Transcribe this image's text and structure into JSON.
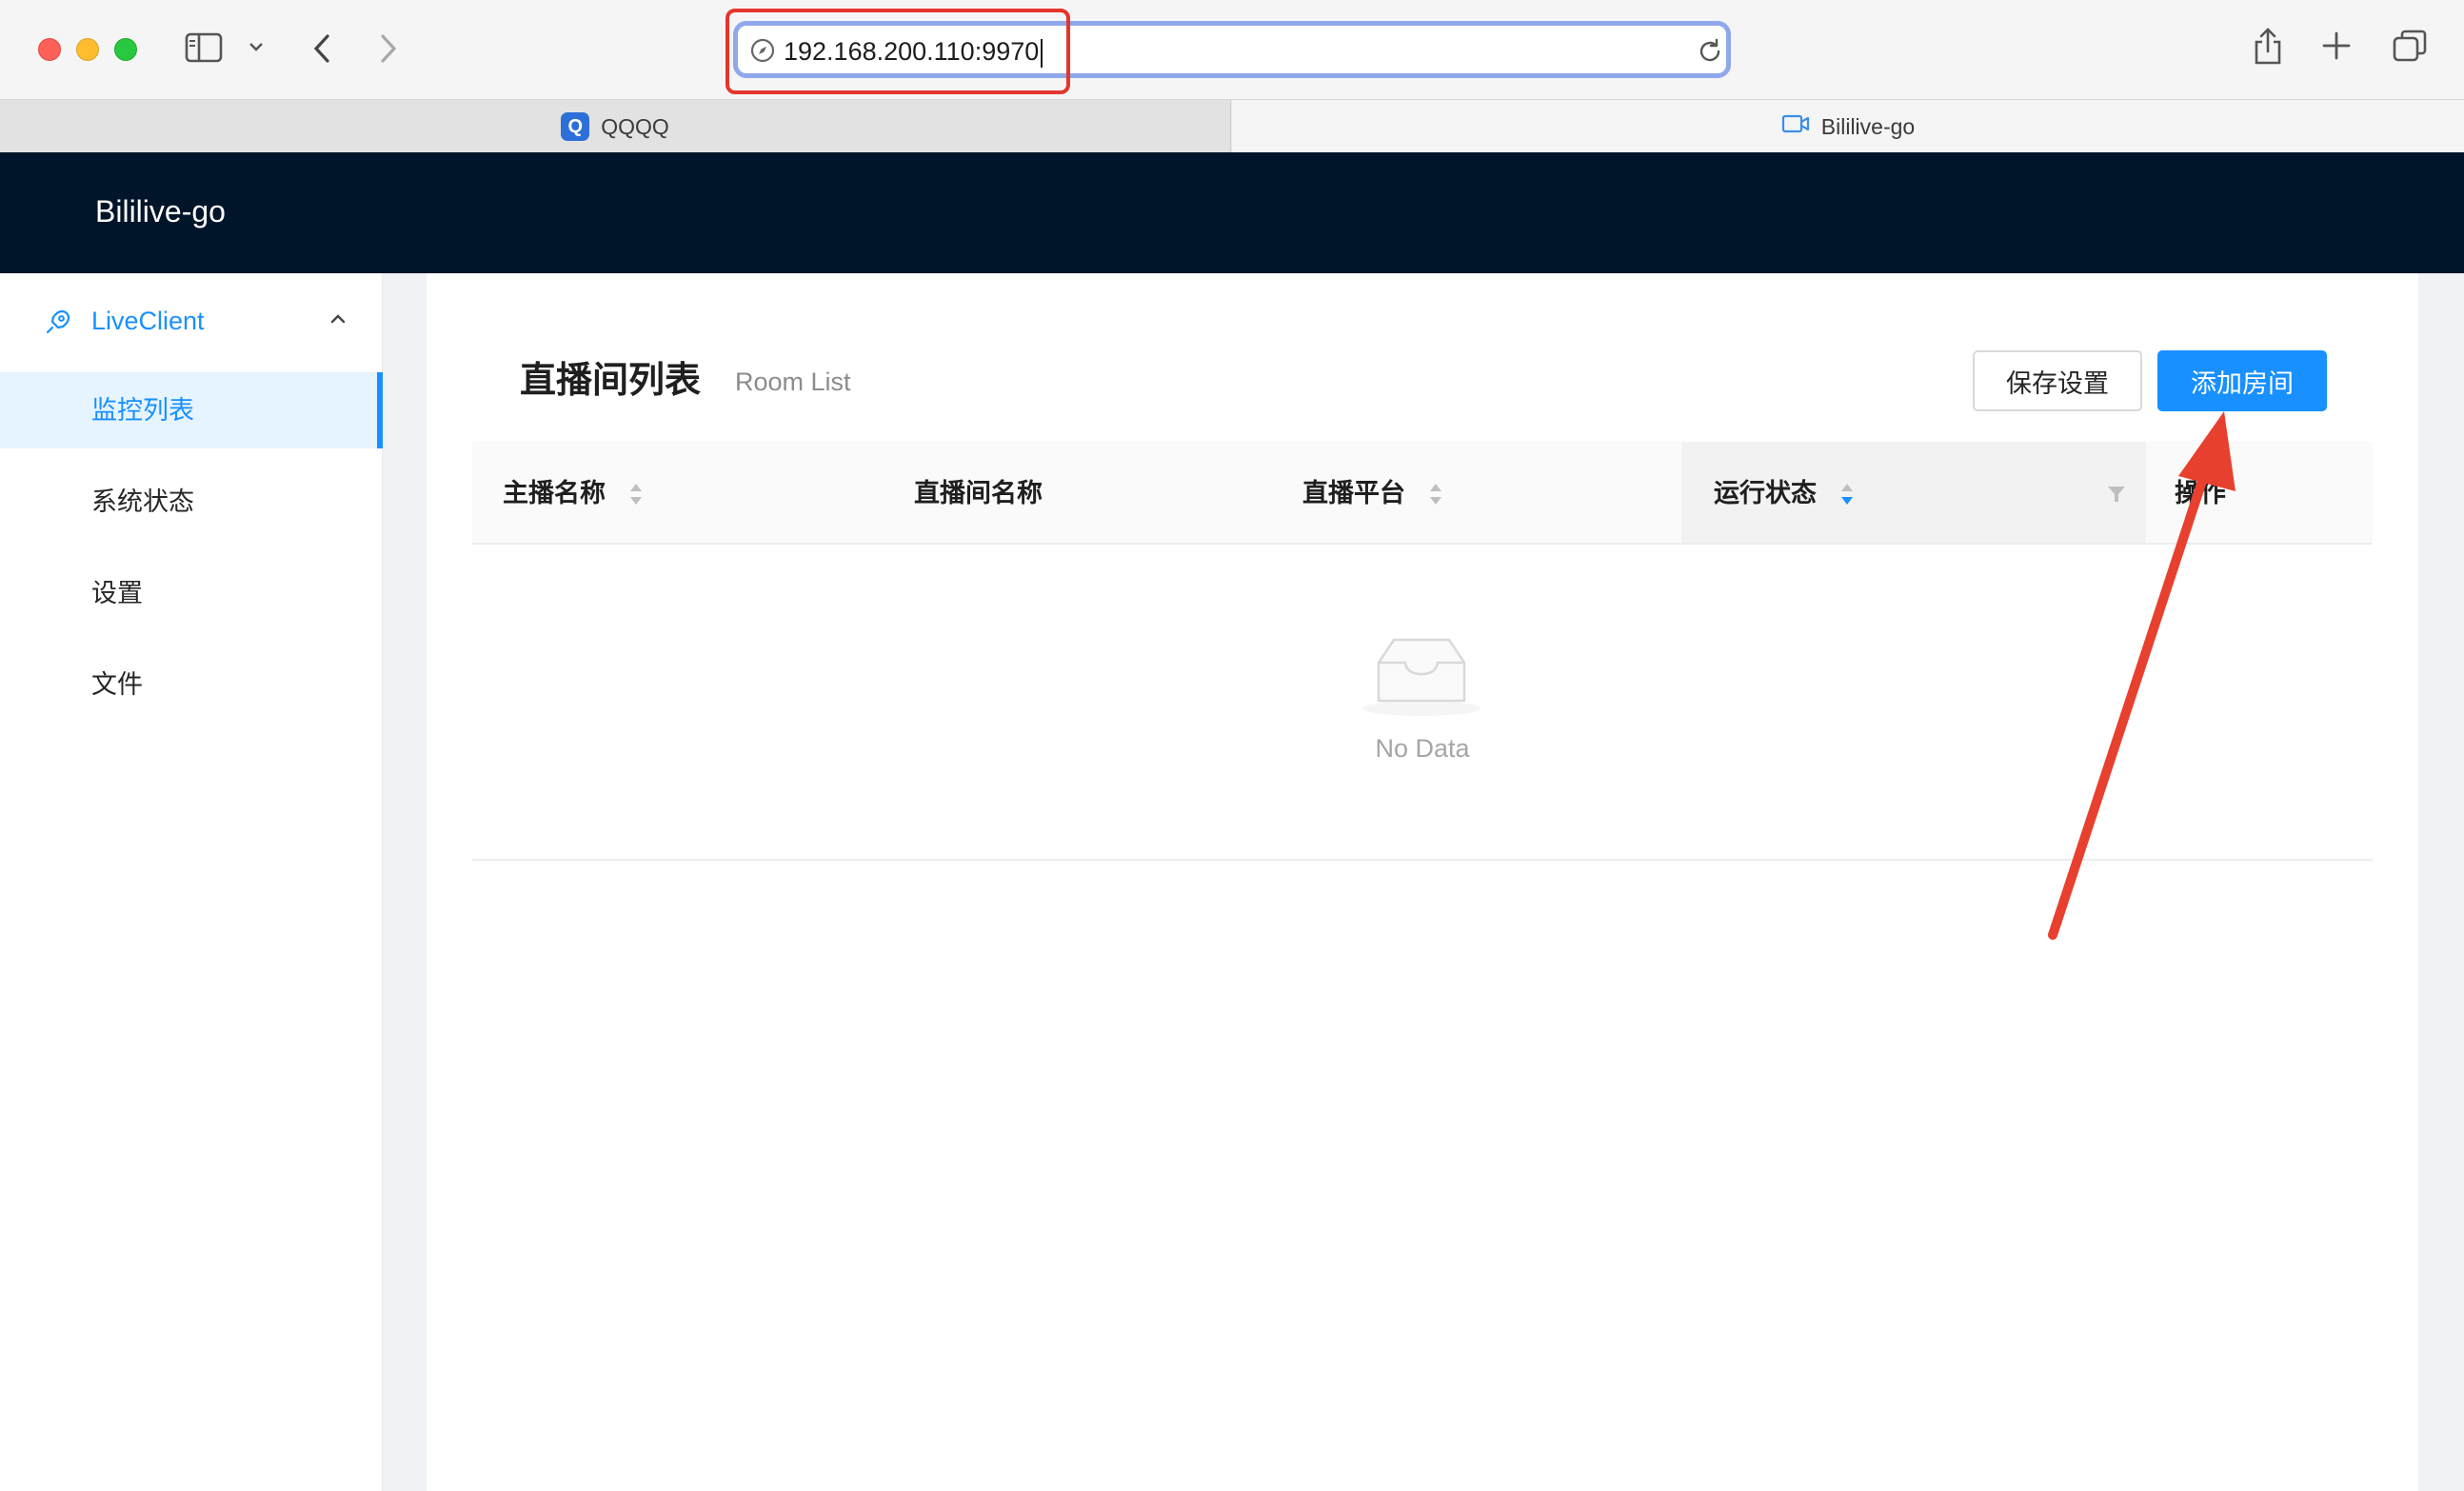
{
  "browser": {
    "address": "192.168.200.110:9970",
    "tabs": [
      {
        "label": "QQQQ",
        "favicon": "q-app-icon"
      },
      {
        "label": "Bililive-go",
        "favicon": "video-camera-icon"
      }
    ]
  },
  "app": {
    "title": "Bililive-go"
  },
  "sidebar": {
    "group": {
      "label": "LiveClient",
      "icon": "rocket-icon"
    },
    "items": [
      {
        "label": "监控列表",
        "active": true
      },
      {
        "label": "系统状态",
        "active": false
      },
      {
        "label": "设置",
        "active": false
      },
      {
        "label": "文件",
        "active": false
      }
    ]
  },
  "page": {
    "title": "直播间列表",
    "subtitle": "Room List",
    "save_button": "保存设置",
    "add_button": "添加房间"
  },
  "table": {
    "columns": [
      "主播名称",
      "直播间名称",
      "直播平台",
      "运行状态",
      "操作"
    ],
    "empty_text": "No Data"
  },
  "colors": {
    "primary": "#1890ff",
    "header_bg": "#001529",
    "annotation": "#e4362c"
  }
}
